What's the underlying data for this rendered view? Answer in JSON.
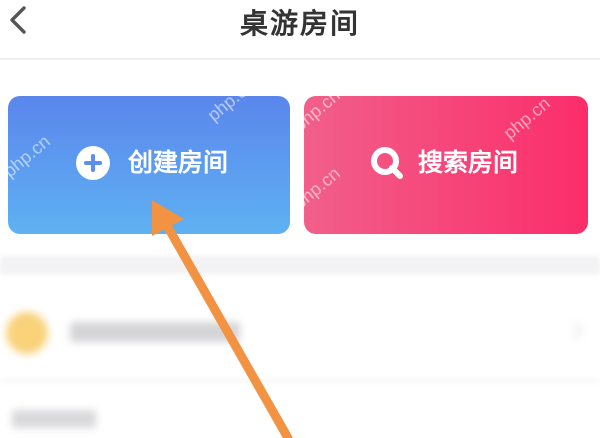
{
  "header": {
    "title": "桌游房间",
    "back_icon": "chevron-left-icon"
  },
  "actions": {
    "create_label": "创建房间",
    "create_icon": "plus-circle-icon",
    "search_label": "搜索房间",
    "search_icon": "search-icon"
  },
  "watermark": "php.cn",
  "colors": {
    "create_gradient": [
      "#5a86ec",
      "#5fb1f3"
    ],
    "search_gradient": [
      "#f15f8a",
      "#fb2d6a"
    ],
    "annotation_arrow": "#f19343"
  }
}
